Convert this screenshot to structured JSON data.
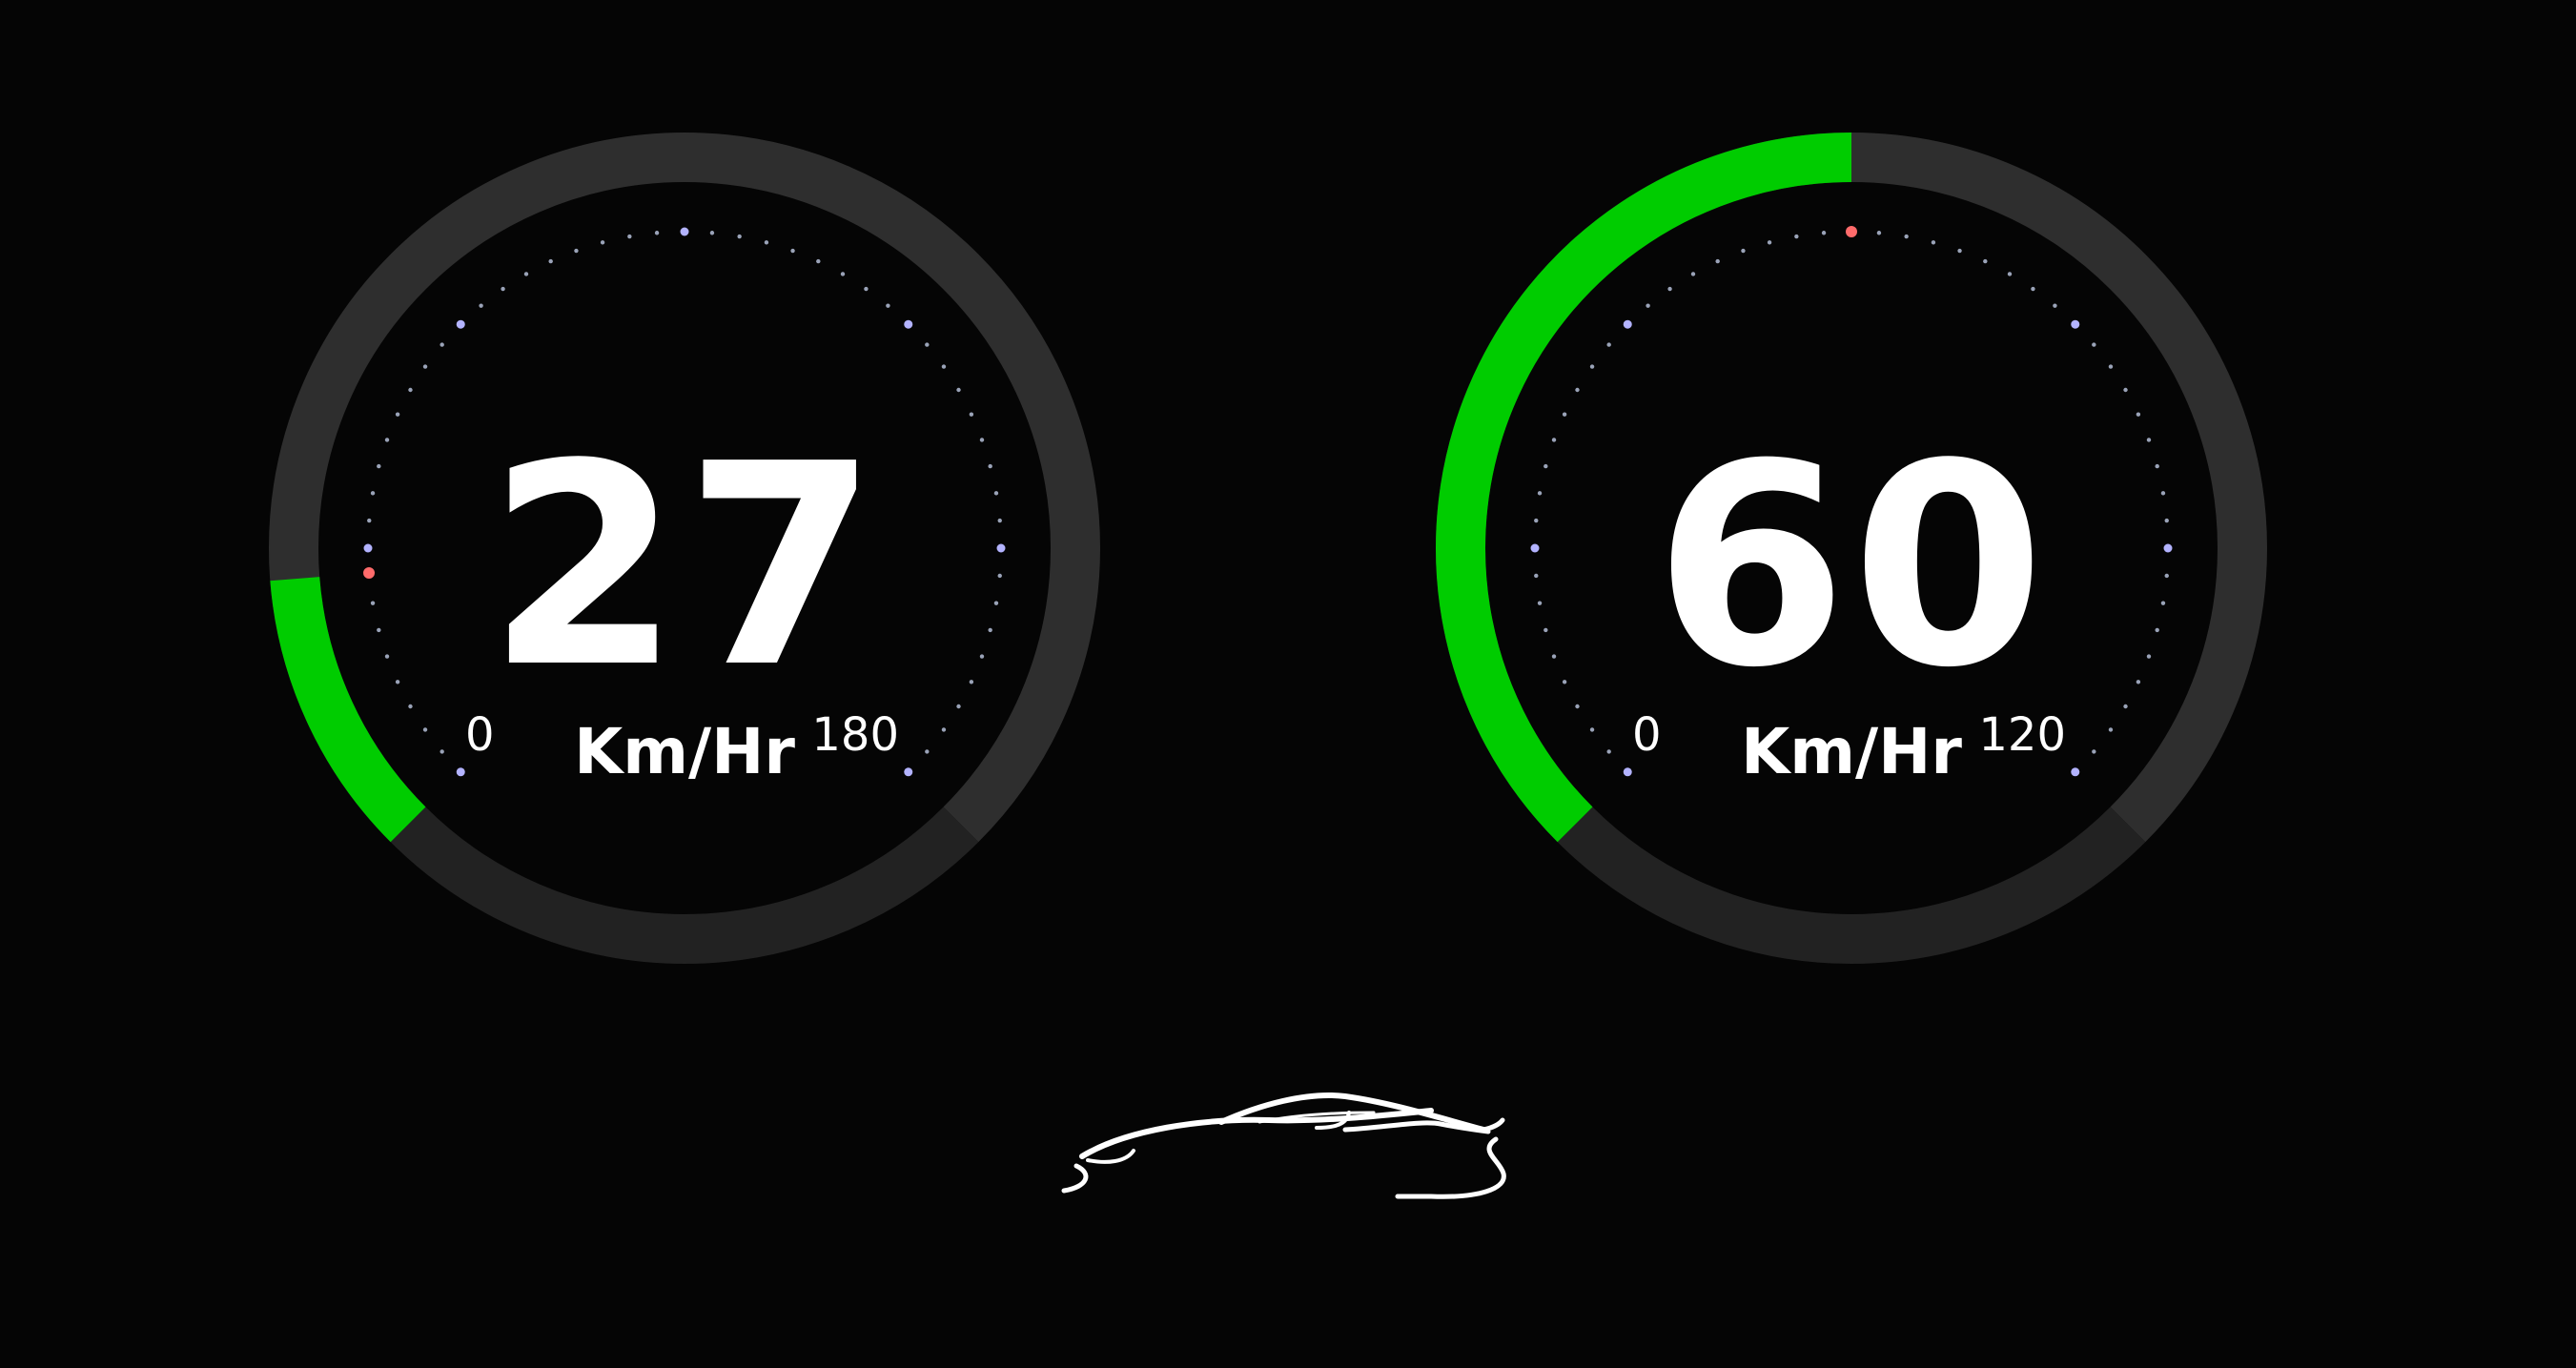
{
  "colors": {
    "background": "#050505",
    "track_upper": "#2e2e2e",
    "track_lower": "#222222",
    "progress": "#00cc00",
    "tick_dim": "#9aa3b8",
    "tick_accent": "#b3b3ff",
    "tick_marker": "#ff6b6b",
    "text": "#ffffff"
  },
  "gauges": [
    {
      "id": "left",
      "value": 27,
      "value_text": "27",
      "unit": "Km/Hr",
      "min_label": "0",
      "max_label": "180",
      "min": 0,
      "max": 180,
      "marker_value": 27
    },
    {
      "id": "right",
      "value": 60,
      "value_text": "60",
      "unit": "Km/Hr",
      "min_label": "0",
      "max_label": "120",
      "min": 0,
      "max": 120,
      "marker_value": 60
    }
  ],
  "icons": {
    "car": "car-silhouette-icon"
  }
}
